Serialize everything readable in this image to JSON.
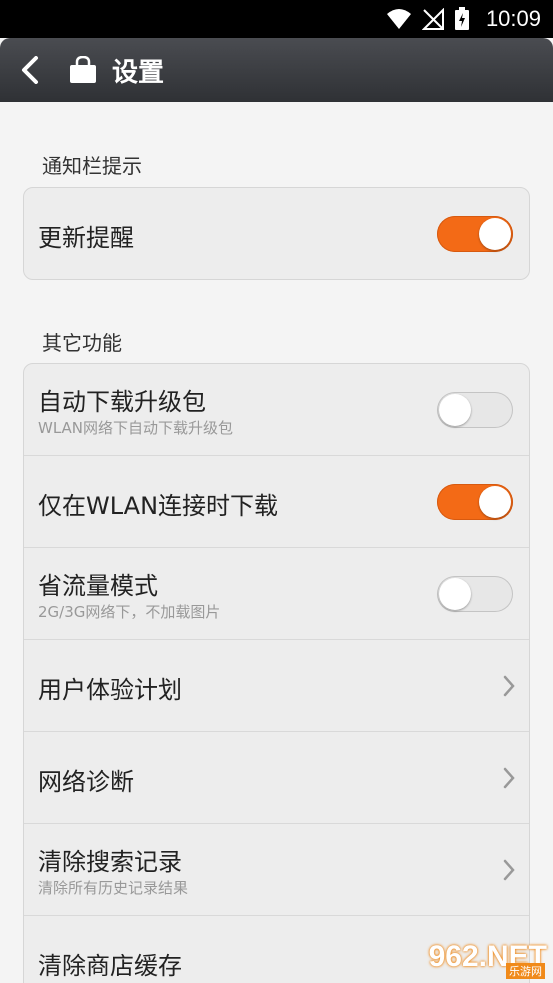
{
  "status_bar": {
    "time": "10:09"
  },
  "header": {
    "title": "设置"
  },
  "sections": [
    {
      "title": "通知栏提示"
    },
    {
      "title": "其它功能"
    }
  ],
  "notify": {
    "update_reminder": {
      "label": "更新提醒",
      "on": true
    }
  },
  "other": {
    "auto_download": {
      "label": "自动下载升级包",
      "sub": "WLAN网络下自动下载升级包",
      "on": false
    },
    "wlan_only": {
      "label": "仅在WLAN连接时下载",
      "on": true
    },
    "save_traffic": {
      "label": "省流量模式",
      "sub": "2G/3G网络下，不加载图片",
      "on": false
    },
    "user_experience": {
      "label": "用户体验计划"
    },
    "network_diag": {
      "label": "网络诊断"
    },
    "clear_search": {
      "label": "清除搜索记录",
      "sub": "清除所有历史记录结果"
    },
    "clear_cache": {
      "label": "清除商店缓存"
    }
  },
  "watermark": {
    "text": "962.NET",
    "sub": "乐游网"
  },
  "colors": {
    "accent": "#f36a16",
    "header": "#3c3e42"
  }
}
